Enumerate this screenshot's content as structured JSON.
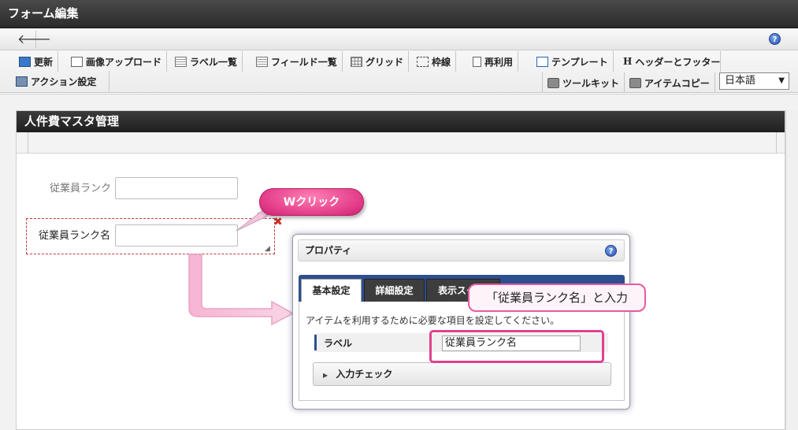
{
  "window": {
    "title": "フォーム編集"
  },
  "nav": {
    "back_glyph": "🡐",
    "help_glyph": "?"
  },
  "toolbar": {
    "row1": [
      {
        "label": "更新",
        "icon": "update-icon"
      },
      {
        "label": "画像アップロード",
        "icon": "image-upload-icon"
      },
      {
        "label": "ラベル一覧",
        "icon": "label-list-icon"
      },
      {
        "label": "フィールド一覧",
        "icon": "field-list-icon"
      },
      {
        "label": "グリッド",
        "icon": "grid-icon"
      },
      {
        "label": "枠線",
        "icon": "border-icon"
      },
      {
        "label": "再利用",
        "icon": "reuse-icon"
      },
      {
        "label": "テンプレート",
        "icon": "template-icon"
      },
      {
        "label": "ヘッダーとフッター",
        "icon": "header-footer-icon",
        "glyph": "H"
      }
    ],
    "row2_left": {
      "label": "アクション設定",
      "icon": "action-settings-icon"
    },
    "toolkit": {
      "label": "ツールキット",
      "icon": "toolkit-icon"
    },
    "item_copy": {
      "label": "アイテムコピー",
      "icon": "item-copy-icon"
    },
    "language": {
      "selected": "日本語",
      "arrow": "▼"
    }
  },
  "form": {
    "title": "人件費マスタ管理",
    "fields": [
      {
        "label": "従業員ランク",
        "value": ""
      },
      {
        "label": "従業員ランク名",
        "value": ""
      }
    ],
    "close_glyph": "✖",
    "grip_glyph": "◢"
  },
  "annotation": {
    "double_click": "Wクリック",
    "input_hint": "「従業員ランク名」と入力"
  },
  "dialog": {
    "title": "プロパティ",
    "help_glyph": "?",
    "tabs": [
      "基本設定",
      "詳細設定",
      "表示スタイル"
    ],
    "description": "アイテムを利用するために必要な項目を設定してください。",
    "property_label": "ラベル",
    "property_value": "従業員ランク名",
    "accordion_label": "入力チェック",
    "accordion_glyph": "▶"
  },
  "colors": {
    "accent_pink": "#e23b88",
    "tab_blue": "#2e4f8f",
    "title_bar": "#2b2b2b"
  }
}
